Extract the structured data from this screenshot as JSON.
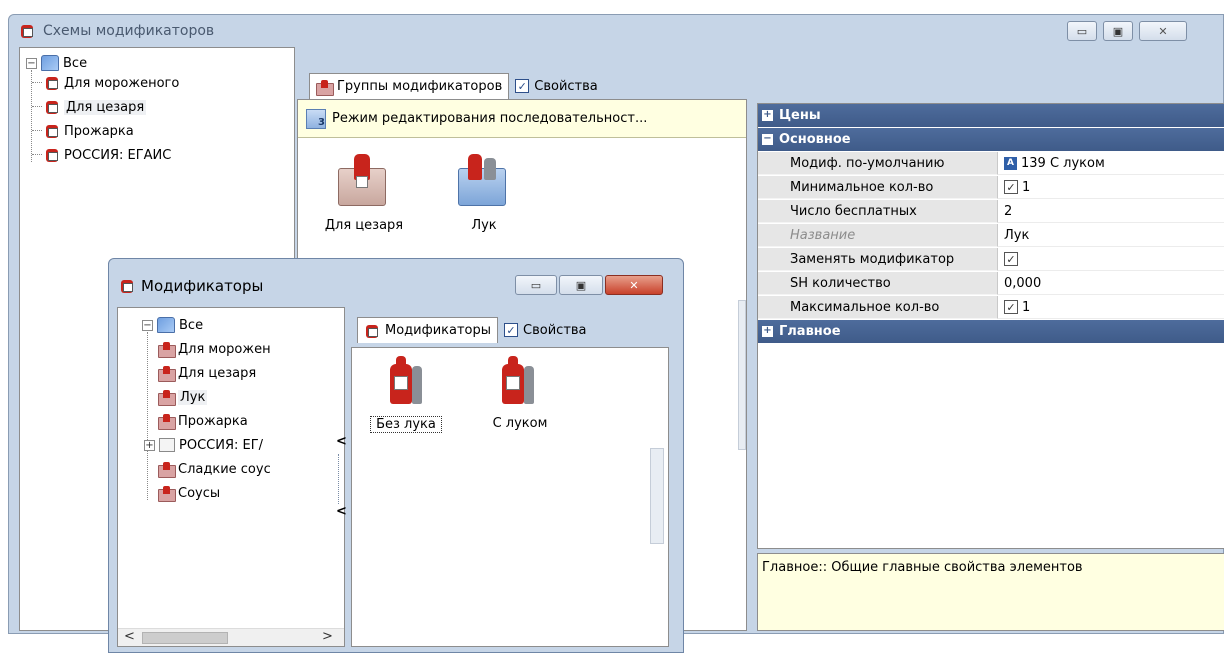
{
  "main_window": {
    "title": "Схемы модификаторов",
    "tree": {
      "root": "Все",
      "items": [
        "Для мороженого",
        "Для цезаря",
        "Прожарка",
        "РОССИЯ: ЕГАИС"
      ]
    },
    "tabs": [
      {
        "label": "Группы модификаторов",
        "icon": "folder-icon"
      },
      {
        "label": "Свойства",
        "icon": "check-icon"
      }
    ],
    "edit_mode_label": "Режим редактирования последовательност...",
    "groups": [
      {
        "label": "Для цезаря",
        "icon": "modifier-folder-icon"
      },
      {
        "label": "Лук",
        "icon": "modifier-folder-icon"
      }
    ],
    "properties": {
      "sections": {
        "prices": "Цены",
        "basic": "Основное",
        "main": "Главное"
      },
      "rows": [
        {
          "name": "Модиф. по-умолчанию",
          "value": "139 С луком",
          "kind": "ref"
        },
        {
          "name": "Минимальное кол-во",
          "value": "1",
          "kind": "check"
        },
        {
          "name": "Число бесплатных",
          "value": "2",
          "kind": "text"
        },
        {
          "name": "Название",
          "value": "Лук",
          "kind": "text",
          "disabled": true
        },
        {
          "name": "Заменять модификатор",
          "value": "",
          "kind": "check"
        },
        {
          "name": "SH количество",
          "value": "0,000",
          "kind": "text"
        },
        {
          "name": "Максимальное кол-во",
          "value": "1",
          "kind": "check"
        }
      ],
      "description": "Главное:: Общие главные свойства элементов"
    },
    "colors": {
      "frame": "#c6d5e7",
      "section_header": "#3f5b89",
      "info_bg": "#ffffe1",
      "description_bg": "#ffffe1"
    }
  },
  "mod_window": {
    "title": "Модификаторы",
    "tree": {
      "root": "Все",
      "items": [
        "Для морожен",
        "Для цезаря",
        "Лук",
        "Прожарка",
        "РОССИЯ: ЕГ/",
        "Сладкие соус",
        "Соусы"
      ]
    },
    "tabs": [
      {
        "label": "Модификаторы",
        "icon": "modifier-icon"
      },
      {
        "label": "Свойства",
        "icon": "check-icon"
      }
    ],
    "items": [
      {
        "label": "Без лука",
        "icon": "sauce-bottle-icon"
      },
      {
        "label": "С луком",
        "icon": "sauce-bottle-icon"
      }
    ]
  },
  "window_buttons": {
    "minimize": "▭",
    "maximize": "▣",
    "close": "✕"
  }
}
